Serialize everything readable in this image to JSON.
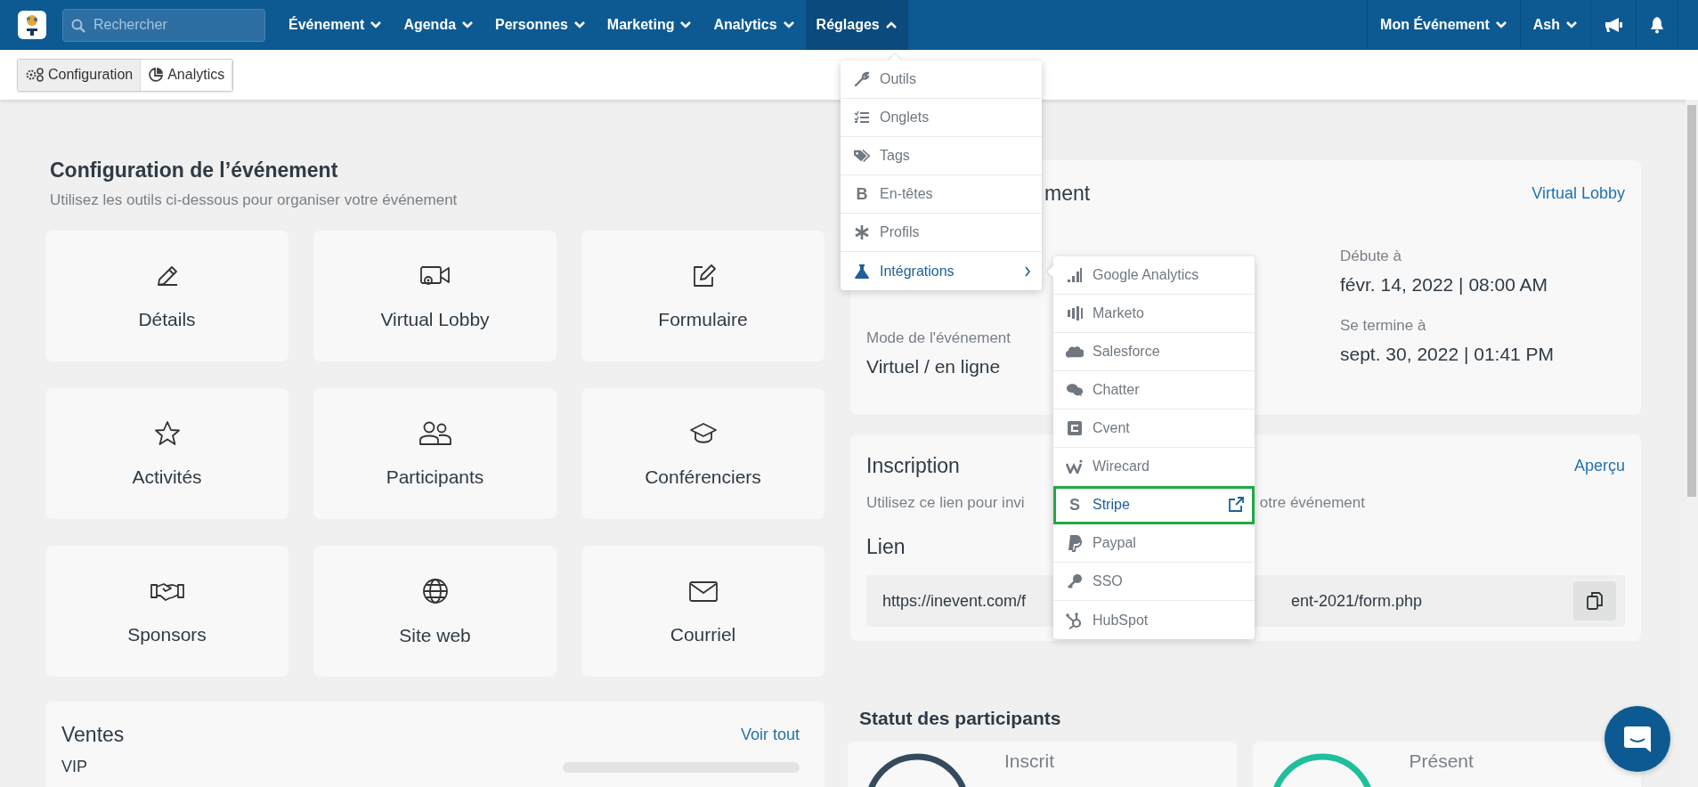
{
  "topbar": {
    "search": {
      "placeholder": "Rechercher"
    },
    "nav": [
      {
        "label": "Événement",
        "selected": false
      },
      {
        "label": "Agenda",
        "selected": false
      },
      {
        "label": "Personnes",
        "selected": false
      },
      {
        "label": "Marketing",
        "selected": false
      },
      {
        "label": "Analytics",
        "selected": false
      },
      {
        "label": "Réglages",
        "selected": true
      }
    ],
    "event_menu": "Mon Événement",
    "user_menu": "Ash"
  },
  "subnav": [
    {
      "label": "Configuration",
      "selected": true
    },
    {
      "label": "Analytics",
      "selected": false
    }
  ],
  "setup": {
    "title": "Configuration de l’événement",
    "subtitle": "Utilisez les outils ci-dessous pour organiser votre événement",
    "tiles": [
      "Détails",
      "Virtual Lobby",
      "Formulaire",
      "Activités",
      "Participants",
      "Conférenciers",
      "Sponsors",
      "Site web",
      "Courriel"
    ]
  },
  "sales": {
    "title": "Ventes",
    "link": "Voir tout",
    "rows": [
      "VIP"
    ]
  },
  "event_card": {
    "title": "ment",
    "link": "Virtual Lobby",
    "mode_label": "Mode de l'événement",
    "mode_value": "Virtuel / en ligne",
    "start_label": "Débute à",
    "start_value": "févr. 14, 2022 | 08:00 AM",
    "end_label": "Se termine à",
    "end_value": "sept. 30, 2022 | 01:41 PM"
  },
  "registration": {
    "title": "Inscription",
    "link": "Aperçu",
    "text_left": "Utilisez ce lien pour invi",
    "text_right": "otre événement",
    "link_label": "Lien",
    "url_left": "https://inevent.com/f",
    "url_right": "ent-2021/form.php"
  },
  "status": {
    "title": "Statut des participants",
    "cards": [
      {
        "label": "Inscrit",
        "color": "#344a5e"
      },
      {
        "label": "Présent",
        "color": "#1fbf9b"
      }
    ]
  },
  "settings_menu": [
    {
      "label": "Outils",
      "selected": false
    },
    {
      "label": "Onglets",
      "selected": false
    },
    {
      "label": "Tags",
      "selected": false
    },
    {
      "label": "En-têtes",
      "selected": false,
      "glyph": "B"
    },
    {
      "label": "Profils",
      "selected": false
    },
    {
      "label": "Intégrations",
      "selected": true,
      "has_submenu": true
    }
  ],
  "integrations_menu": [
    {
      "label": "Google Analytics",
      "selected": false
    },
    {
      "label": "Marketo",
      "selected": false
    },
    {
      "label": "Salesforce",
      "selected": false
    },
    {
      "label": "Chatter",
      "selected": false
    },
    {
      "label": "Cvent",
      "selected": false
    },
    {
      "label": "Wirecard",
      "selected": false
    },
    {
      "label": "Stripe",
      "selected": true,
      "glyph": "S"
    },
    {
      "label": "Paypal",
      "selected": false
    },
    {
      "label": "SSO",
      "selected": false
    },
    {
      "label": "HubSpot",
      "selected": false
    }
  ]
}
